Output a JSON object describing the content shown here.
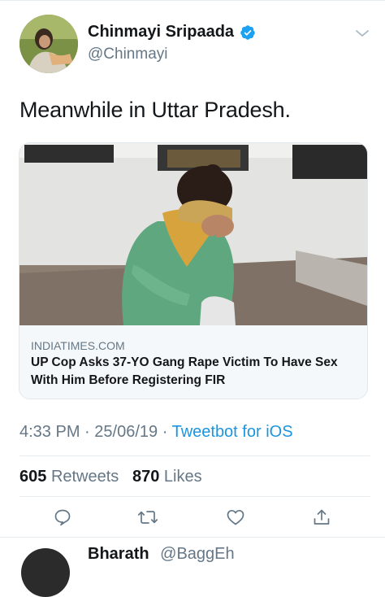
{
  "tweet": {
    "display_name": "Chinmayi Sripaada",
    "handle": "@Chinmayi",
    "text": "Meanwhile in Uttar Pradesh.",
    "card": {
      "domain": "INDIATIMES.COM",
      "title": "UP Cop Asks 37-YO Gang Rape Victim To Have Sex With Him Before Registering FIR"
    },
    "time": "4:33 PM",
    "date": "25/06/19",
    "separator": "·",
    "source": "Tweetbot for iOS",
    "retweets_count": "605",
    "retweets_label": "Retweets",
    "likes_count": "870",
    "likes_label": "Likes"
  },
  "next_tweet": {
    "display_name": "Bharath",
    "handle": "@BaggEh"
  },
  "icons": {
    "verified": "verified-badge-icon",
    "menu": "chevron-down-icon",
    "reply": "reply-icon",
    "retweet": "retweet-icon",
    "like": "heart-icon",
    "share": "share-icon"
  },
  "colors": {
    "accent": "#1b95e0",
    "secondary_text": "#657786",
    "primary_text": "#14171a",
    "divider": "#e6ecf0"
  }
}
